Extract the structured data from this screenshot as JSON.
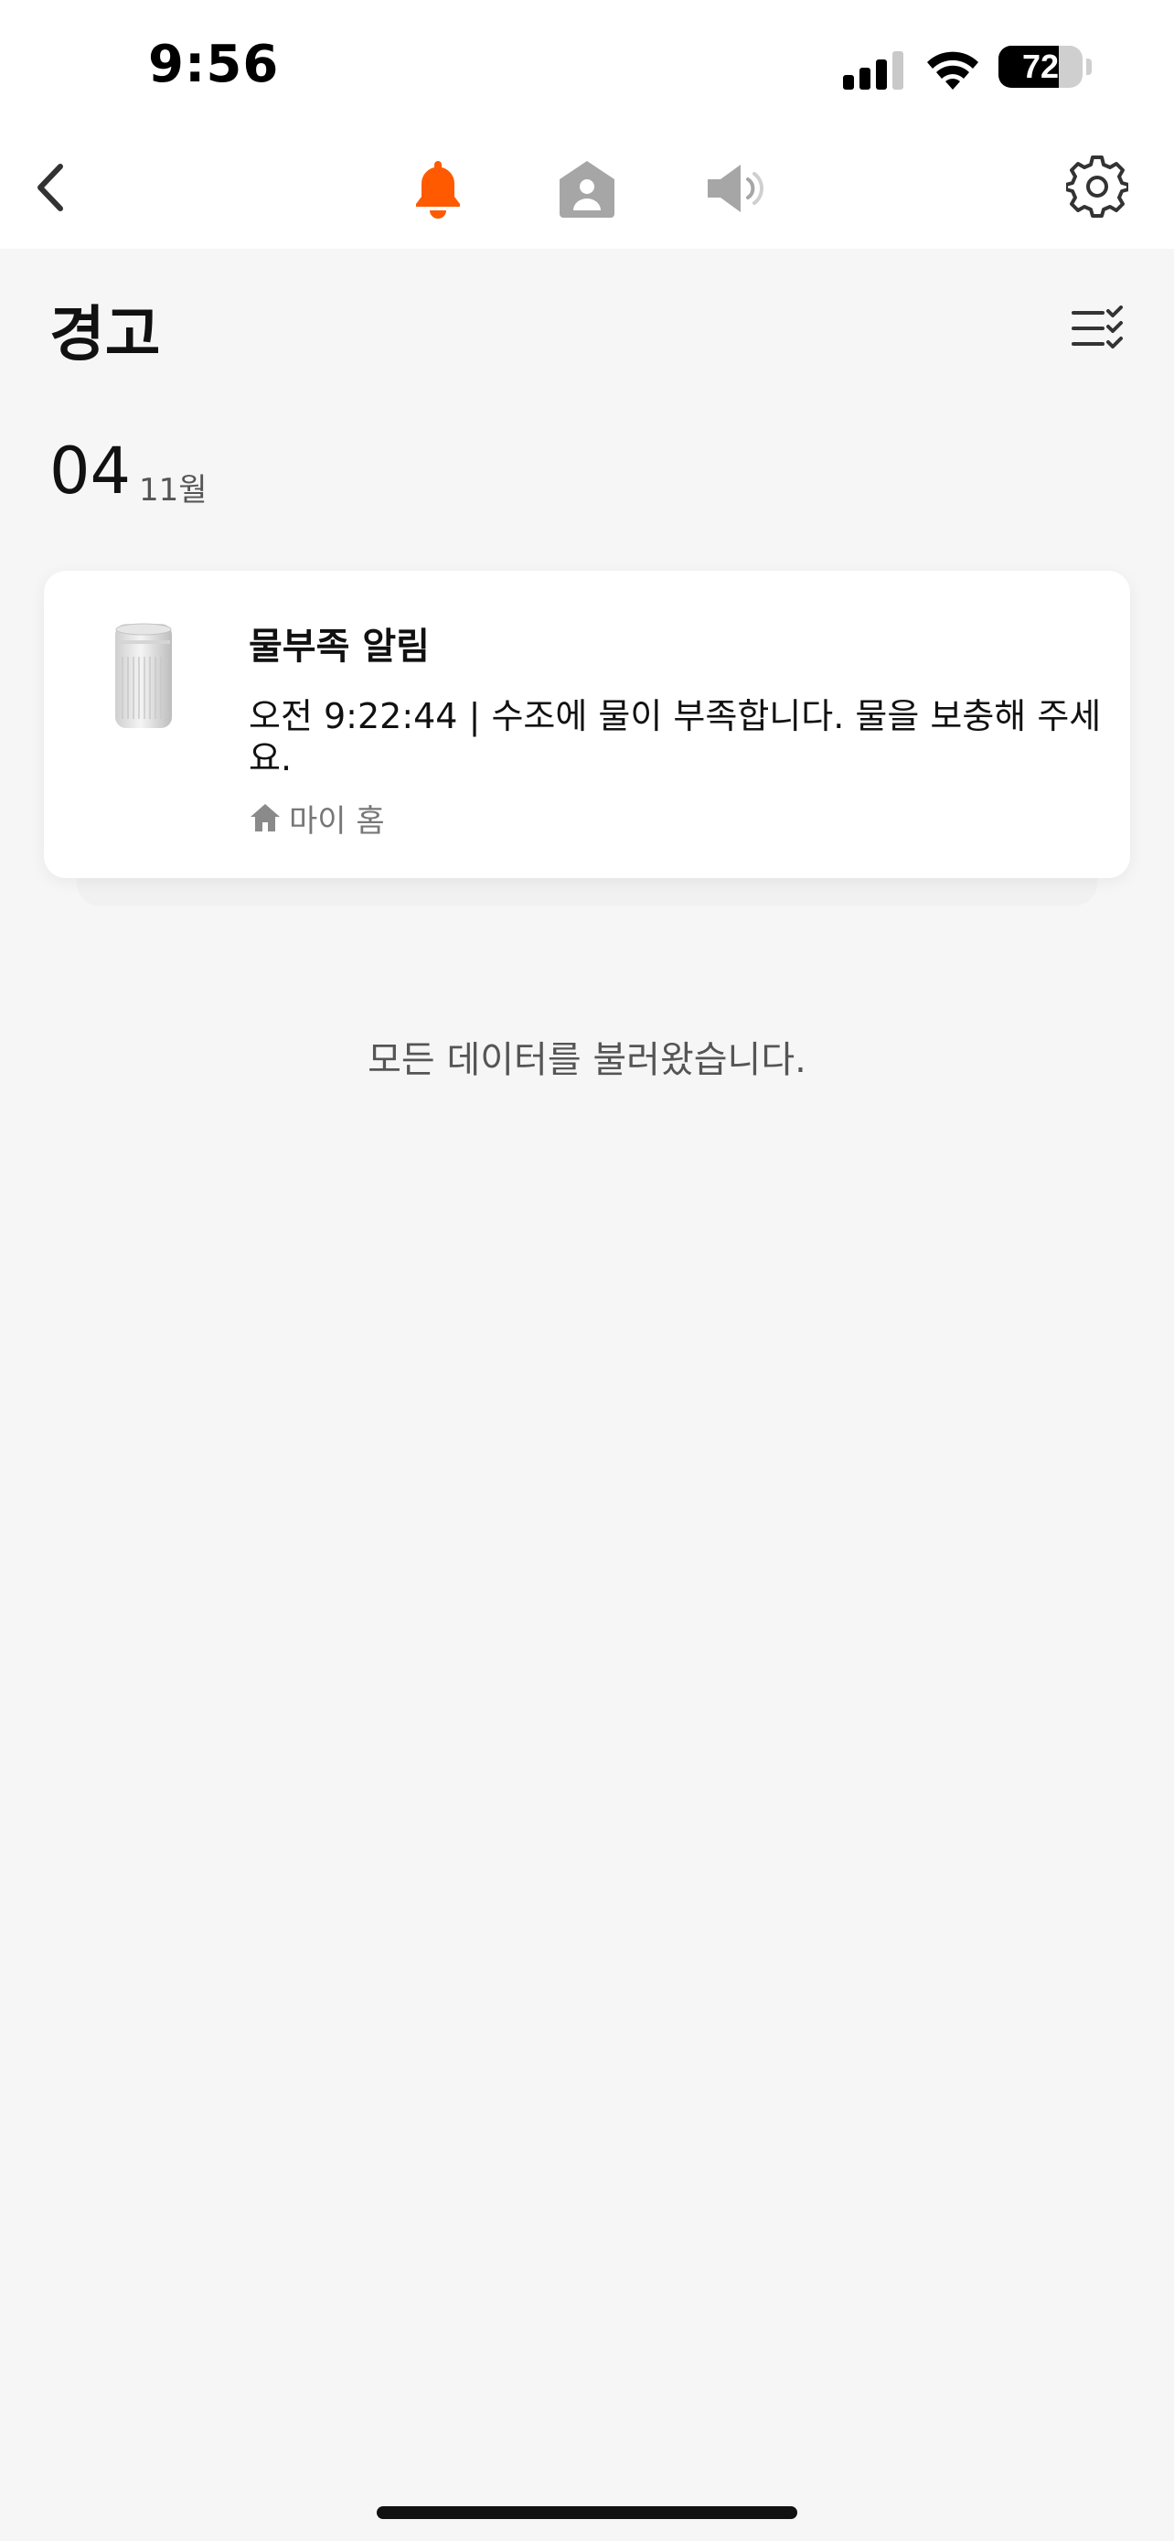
{
  "status_bar": {
    "time": "9:56",
    "battery_level": "72",
    "battery_fraction": 0.72
  },
  "nav": {
    "icons": [
      "back-icon",
      "bell-icon",
      "home-user-icon",
      "speaker-icon",
      "gear-icon"
    ],
    "active": "bell",
    "accent_color": "#ff5a00",
    "inactive_color": "#a6a6a6"
  },
  "page": {
    "title": "경고"
  },
  "date_group": {
    "day": "04",
    "month": "11월"
  },
  "alerts": [
    {
      "title": "물부족 알림",
      "message": "오전 9:22:44 | 수조에 물이 부족합니다. 물을 보충해 주세요.",
      "location": "마이 홈",
      "device_icon": "air-purifier-image"
    }
  ],
  "footer": {
    "text": "모든 데이터를 불러왔습니다."
  }
}
